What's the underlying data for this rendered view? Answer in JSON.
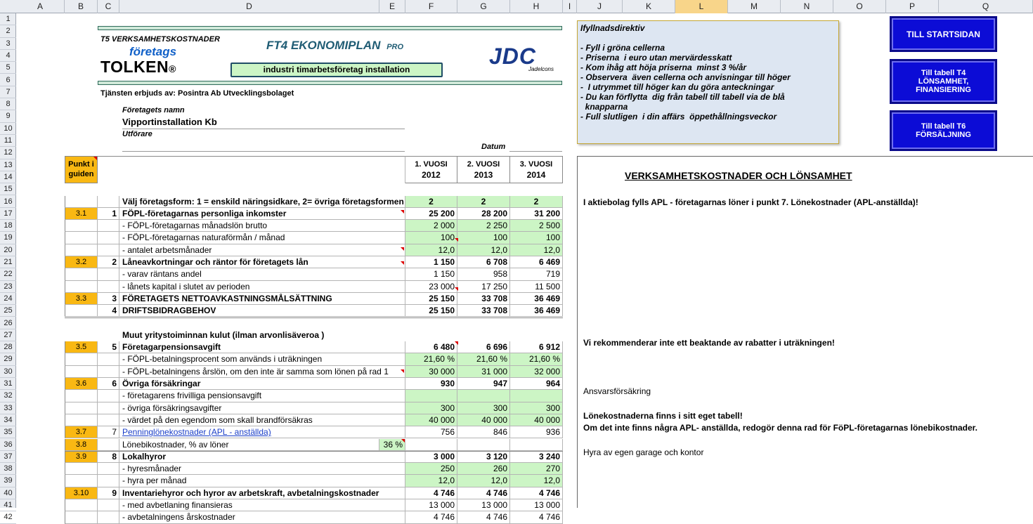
{
  "columns": [
    "A",
    "B",
    "C",
    "D",
    "E",
    "F",
    "G",
    "H",
    "I",
    "J",
    "K",
    "L",
    "M",
    "N",
    "O",
    "P",
    "Q"
  ],
  "rows": [
    "1",
    "2",
    "3",
    "4",
    "5",
    "6",
    "7",
    "8",
    "9",
    "10",
    "11",
    "12",
    "13",
    "14",
    "15",
    "16",
    "17",
    "18",
    "19",
    "20",
    "21",
    "22",
    "23",
    "24",
    "25",
    "26",
    "27",
    "28",
    "29",
    "30",
    "31",
    "32",
    "33",
    "34",
    "35",
    "36",
    "37",
    "38",
    "39",
    "40",
    "41",
    "42"
  ],
  "header": {
    "t5": "T5 VERKSAMHETSKOSTNADER",
    "brand_small": "företags",
    "brand_big": "TOLKEN",
    "reg": "®",
    "title": "FT4 EKONOMIPLAN",
    "title_suffix": "PRO",
    "industry": "industri  timarbetsföretag  installation",
    "jdc": "JDC",
    "jdc_sub": "Jadelcons",
    "provider": "Tjänsten erbjuds av: Posintra Ab Utvecklingsbolaget",
    "company_label": "Företagets namn",
    "company_name": "Vipportinstallation Kb",
    "performer_label": "Utförare",
    "date_label": "Datum"
  },
  "instructions": {
    "title": "Ifyllnadsdirektiv",
    "lines": [
      "- Fyll i gröna cellerna",
      "- Priserna  i euro utan mervärdesskatt",
      "- Kom ihåg att höja priserna  minst 3 %/år",
      "- Observera  även cellerna och anvisningar till höger",
      "-  I utrymmet till höger kan du göra anteckningar",
      "- Du kan förflytta  dig från tabell till tabell via de blå",
      "  knapparna",
      "- Full slutligen  i din affärs  öppethållningsveckor"
    ]
  },
  "buttons": {
    "start": "TILL STARTSIDAN",
    "t4": "Till tabell T4 LÖNSAMHET, FINANSIERING",
    "t6": "Till tabell T6 FÖRSÄLJNING"
  },
  "table_head": {
    "punkt": "Punkt i guiden",
    "years": [
      {
        "label": "1. VUOSI",
        "year": "2012"
      },
      {
        "label": "2. VUOSI",
        "year": "2013"
      },
      {
        "label": "3. VUOSI",
        "year": "2014"
      }
    ]
  },
  "table_rows": [
    {
      "row": "16",
      "punkt": "",
      "num": "",
      "label": "Välj företagsform: 1 = enskild näringsidkare, 2= övriga företagsformen",
      "bold": true,
      "v": [
        "2",
        "2",
        "2"
      ],
      "green": true,
      "center": true
    },
    {
      "row": "17",
      "punkt": "3.1",
      "num": "1",
      "label": "FÖPL-företagarnas personliga inkomster",
      "bold": true,
      "v": [
        "25 200",
        "28 200",
        "31 200"
      ],
      "green": false
    },
    {
      "row": "18",
      "punkt": "",
      "num": "",
      "label": "- FÖPL-företagarnas månadslön brutto",
      "bold": false,
      "v": [
        "2 000",
        "2 250",
        "2 500"
      ],
      "green": true
    },
    {
      "row": "19",
      "punkt": "",
      "num": "",
      "label": "- FÖPL-företagarnas naturaförmån / månad",
      "bold": false,
      "v": [
        "100",
        "100",
        "100"
      ],
      "green": true
    },
    {
      "row": "20",
      "punkt": "",
      "num": "",
      "label": "- antalet arbetsmånader",
      "bold": false,
      "v": [
        "12,0",
        "12,0",
        "12,0"
      ],
      "green": true
    },
    {
      "row": "21",
      "punkt": "3.2",
      "num": "2",
      "label": "Låneavkortningar och räntor för företagets lån",
      "bold": true,
      "v": [
        "1 150",
        "6 708",
        "6 469"
      ],
      "green": false
    },
    {
      "row": "22",
      "punkt": "",
      "num": "",
      "label": "- varav räntans andel",
      "bold": false,
      "v": [
        "1 150",
        "958",
        "719"
      ],
      "green": false
    },
    {
      "row": "23",
      "punkt": "",
      "num": "",
      "label": "- lånets kapital i slutet av perioden",
      "bold": false,
      "v": [
        "23 000",
        "17 250",
        "11 500"
      ],
      "green": false
    },
    {
      "row": "24",
      "punkt": "3.3",
      "num": "3",
      "label": "FÖRETAGETS NETTOAVKASTNINGSMÅLSÄTTNING",
      "bold": true,
      "v": [
        "25 150",
        "33 708",
        "36 469"
      ],
      "green": false
    },
    {
      "row": "25",
      "punkt": "",
      "num": "4",
      "label": "DRIFTSBIDRAGBEHOV",
      "bold": true,
      "v": [
        "25 150",
        "33 708",
        "36 469"
      ],
      "green": false
    },
    {
      "row": "27",
      "punkt": "",
      "num": "",
      "label": "Muut yritystoiminnan kulut (ilman arvonlisäveroa )",
      "bold": true,
      "v": [
        "",
        "",
        ""
      ],
      "green": false,
      "plain": true
    },
    {
      "row": "28",
      "punkt": "3.5",
      "num": "5",
      "label": "Företagarpensionsavgift",
      "bold": true,
      "v": [
        "6 480",
        "6 696",
        "6 912"
      ],
      "green": false
    },
    {
      "row": "29",
      "punkt": "",
      "num": "",
      "label": "- FÖPL-betalningsprocent som används i uträkningen",
      "bold": false,
      "v": [
        "21,60 %",
        "21,60 %",
        "21,60 %"
      ],
      "green": true
    },
    {
      "row": "30",
      "punkt": "",
      "num": "",
      "label": "- FÖPL-betalningens årslön, om den inte är samma som lönen på rad 1",
      "bold": false,
      "v": [
        "30 000",
        "31 000",
        "32 000"
      ],
      "green": true
    },
    {
      "row": "31",
      "punkt": "3.6",
      "num": "6",
      "label": "Övriga försäkringar",
      "bold": true,
      "v": [
        "930",
        "947",
        "964"
      ],
      "green": false
    },
    {
      "row": "32",
      "punkt": "",
      "num": "",
      "label": "- företagarens frivilliga pensionsavgift",
      "bold": false,
      "v": [
        "",
        "",
        ""
      ],
      "green": true
    },
    {
      "row": "33",
      "punkt": "",
      "num": "",
      "label": "- övriga försäkringsavgifter",
      "bold": false,
      "v": [
        "300",
        "300",
        "300"
      ],
      "green": true
    },
    {
      "row": "34",
      "punkt": "",
      "num": "",
      "label": "- värdet på den egendom som skall brandförsäkras",
      "bold": false,
      "v": [
        "40 000",
        "40 000",
        "40 000"
      ],
      "green": true
    },
    {
      "row": "35",
      "punkt": "3.7",
      "num": "7",
      "label": "Penninglönekostnader (APL - anställda)",
      "bold": false,
      "link": true,
      "v": [
        "756",
        "846",
        "936"
      ],
      "green": false
    },
    {
      "row": "36",
      "punkt": "3.8",
      "num": "",
      "label": "Lönebikostnader, % av löner",
      "bold": false,
      "extra": "36 %",
      "v": [
        "",
        "",
        ""
      ],
      "green": false
    },
    {
      "row": "37",
      "punkt": "3.9",
      "num": "8",
      "label": "Lokalhyror",
      "bold": true,
      "v": [
        "3 000",
        "3 120",
        "3 240"
      ],
      "green": false
    },
    {
      "row": "38",
      "punkt": "",
      "num": "",
      "label": "- hyresmånader",
      "bold": false,
      "v": [
        "250",
        "260",
        "270"
      ],
      "green": true
    },
    {
      "row": "39",
      "punkt": "",
      "num": "",
      "label": "- hyra per månad",
      "bold": false,
      "v": [
        "12,0",
        "12,0",
        "12,0"
      ],
      "green": true
    },
    {
      "row": "40",
      "punkt": "3.10",
      "num": "9",
      "label": "Inventariehyror och hyror av arbetskraft, avbetalningskostnader",
      "bold": true,
      "v": [
        "4 746",
        "4 746",
        "4 746"
      ],
      "green": false
    },
    {
      "row": "41",
      "punkt": "",
      "num": "",
      "label": "- med avbetlaning finansieras",
      "bold": false,
      "v": [
        "13 000",
        "13 000",
        "13 000"
      ],
      "green": false
    },
    {
      "row": "42",
      "punkt": "",
      "num": "",
      "label": "- avbetalningens årskostnader",
      "bold": false,
      "v": [
        "4 746",
        "4 746",
        "4 746"
      ],
      "green": false
    }
  ],
  "notes": {
    "title": "VERKSAMHETSKOSTNADER OCH LÖNSAMHET",
    "n17": "I aktiebolag fylls APL - företagarnas löner i punkt 7. Lönekostnader (APL-anställda)!",
    "n29": "Vi rekommenderar inte ett beaktande av rabatter i uträkningen!",
    "n33": "Ansvarsförsäkring",
    "n35": "Lönekostnaderna finns i sitt eget tabell!",
    "n36": "Om det inte finns några APL- anställda, redogör denna rad för FöPL-företagarnas lönebikostnader.",
    "n38": "Hyra av egen garage och kontor"
  },
  "colors": {
    "green": "#ccf5c5",
    "orange": "#f9b813",
    "button": "#0c0cd6",
    "note": "#dde6f2"
  }
}
